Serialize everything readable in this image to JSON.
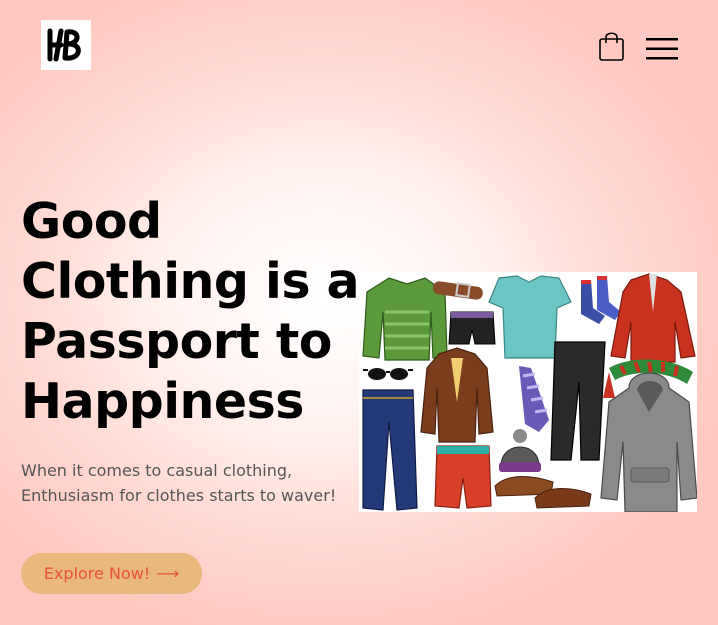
{
  "header": {
    "logo_alt": "HB",
    "cart_icon": "shopping-bag-icon",
    "menu_icon": "hamburger-menu-icon"
  },
  "hero": {
    "headline": "Good Clothing is a Passport to Happiness",
    "subtext": "When it comes to casual clothing, Enthusiasm for clothes starts to waver!",
    "cta_label": "Explore Now!",
    "cta_arrow": "⟶",
    "image_alt": "assorted clothing illustration"
  },
  "colors": {
    "cta_background": "#e8b87c",
    "cta_text": "#e8523a",
    "background": "#ffd9d2"
  }
}
